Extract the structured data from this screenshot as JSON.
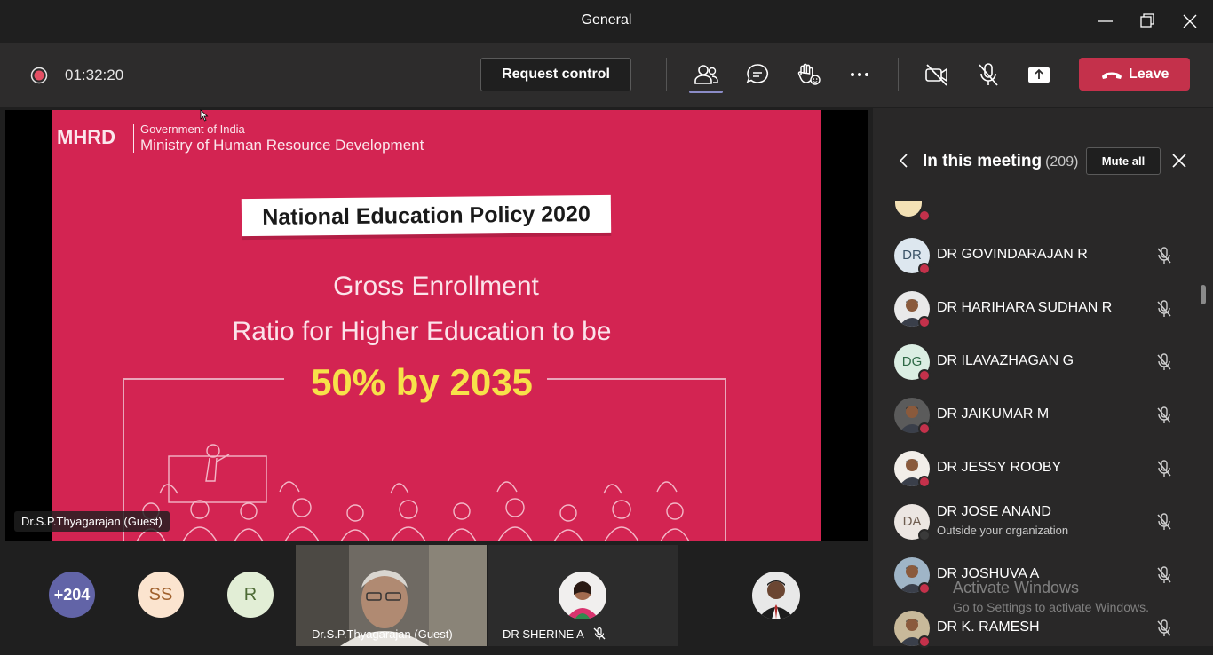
{
  "window": {
    "title": "General"
  },
  "toolbar": {
    "timer": "01:32:20",
    "request_control": "Request control",
    "leave": "Leave",
    "icons": [
      "record-icon",
      "participants-icon",
      "chat-icon",
      "raise-hand-icon",
      "more-icon",
      "camera-off-icon",
      "mic-off-icon",
      "share-icon",
      "phone-hangup-icon"
    ],
    "colors": {
      "leave": "#c4314b",
      "active_underline": "#8b8cc7",
      "record": "#e34f64"
    }
  },
  "stage": {
    "speaker_label": "Dr.S.P.Thyagarajan (Guest)",
    "slide": {
      "logo": "MHRD",
      "gov": "Government of India",
      "ministry": "Ministry of Human Resource Development",
      "banner": "National Education Policy 2020",
      "line1": "Gross Enrollment",
      "line2": "Ratio for Higher Education to be",
      "line3": "50% by 2035",
      "colors": {
        "background": "#d32452",
        "highlight": "#f7e14a"
      }
    }
  },
  "gallery": {
    "more_count": "+204",
    "avatars": [
      {
        "initials": "SS"
      },
      {
        "initials": "R"
      }
    ],
    "video_tile_name": "Dr.S.P.Thyagarajan (Guest)",
    "sherine_name": "DR SHERINE A"
  },
  "panel": {
    "title": "In this meeting",
    "count": "(209)",
    "mute_all": "Mute all",
    "participants": [
      {
        "name": "DR GOVINDARAJAN R",
        "initials": "DR",
        "avatar": "initials",
        "bg": "#dde7ef",
        "fg": "#3b5468",
        "sub": ""
      },
      {
        "name": "DR HARIHARA SUDHAN R",
        "initials": "",
        "avatar": "photo",
        "bg": "#e9e9e9",
        "fg": "#333",
        "sub": ""
      },
      {
        "name": "DR ILAVAZHAGAN G",
        "initials": "DG",
        "avatar": "initials",
        "bg": "#dbeee3",
        "fg": "#2f6a47",
        "sub": ""
      },
      {
        "name": "DR JAIKUMAR M",
        "initials": "",
        "avatar": "photo",
        "bg": "#5b5b5b",
        "fg": "#fff",
        "sub": ""
      },
      {
        "name": "DR JESSY ROOBY",
        "initials": "",
        "avatar": "photo",
        "bg": "#f2eee9",
        "fg": "#333",
        "sub": ""
      },
      {
        "name": "DR JOSE ANAND",
        "initials": "DA",
        "avatar": "initials",
        "bg": "#ece6e2",
        "fg": "#6f5d50",
        "sub": "Outside your organization"
      },
      {
        "name": "DR JOSHUVA A",
        "initials": "",
        "avatar": "photo",
        "bg": "#9fb5c7",
        "fg": "#fff",
        "sub": ""
      },
      {
        "name": "DR K. RAMESH",
        "initials": "",
        "avatar": "photo",
        "bg": "#c8b99a",
        "fg": "#fff",
        "sub": ""
      }
    ]
  },
  "watermark": {
    "title": "Activate Windows",
    "subtitle": "Go to Settings to activate Windows."
  }
}
